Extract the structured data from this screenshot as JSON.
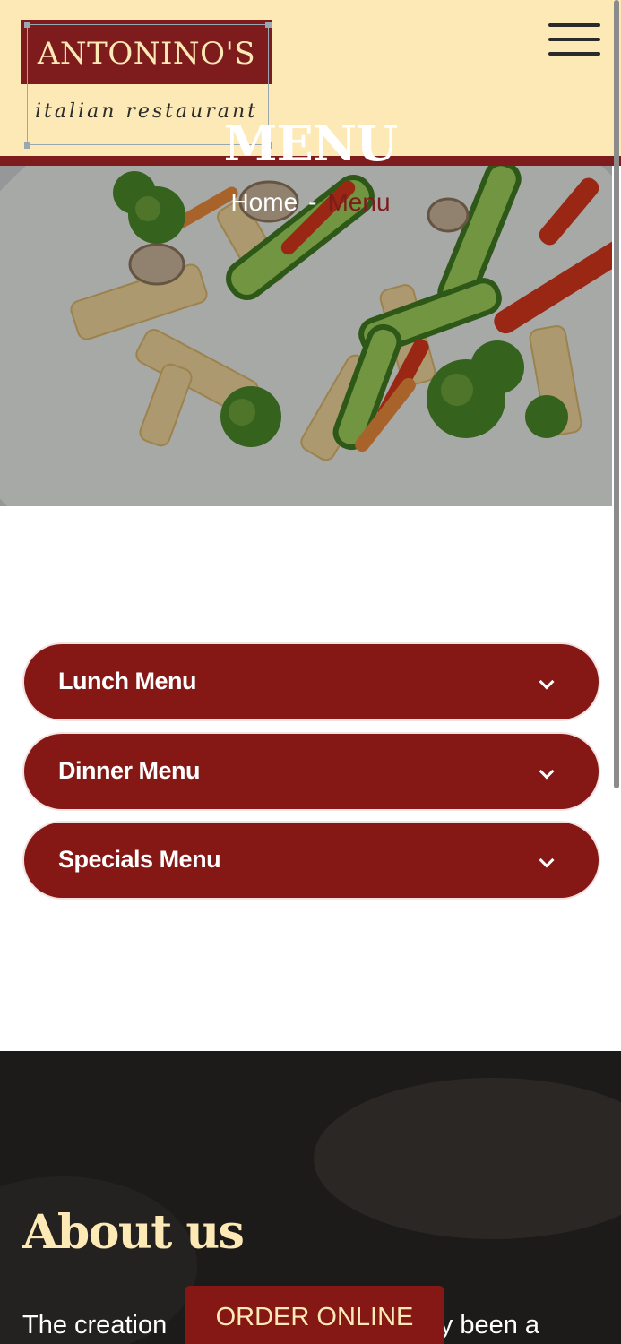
{
  "header": {
    "logo_name": "ANTONINO'S",
    "logo_subtitle": "italian restaurant",
    "menu_icon": "hamburger-menu-icon"
  },
  "hero": {
    "title": "MENU",
    "breadcrumb": {
      "home": "Home",
      "separator": "-",
      "current": "Menu"
    }
  },
  "accordion": {
    "items": [
      {
        "label": "Lunch Menu",
        "icon": "chevron-down-icon"
      },
      {
        "label": "Dinner Menu",
        "icon": "chevron-down-icon"
      },
      {
        "label": "Specials Menu",
        "icon": "chevron-down-icon"
      }
    ]
  },
  "about": {
    "title": "About us",
    "text": "The creation                                   uly been a"
  },
  "order": {
    "label": "ORDER ONLINE"
  },
  "colors": {
    "header_bg": "#fce9b6",
    "brand_red": "#851815",
    "dark_red": "#7e1c1d",
    "about_bg": "#1d1b19"
  }
}
